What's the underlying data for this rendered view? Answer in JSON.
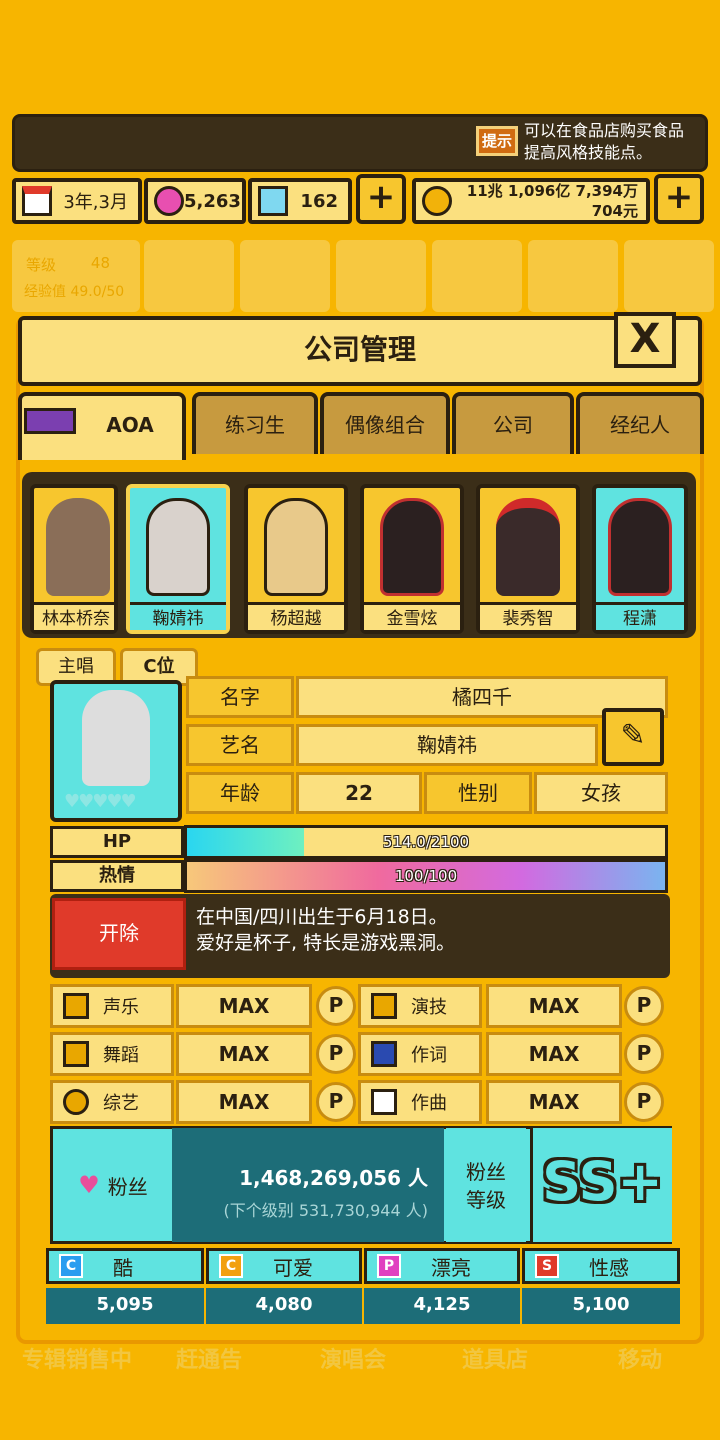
{
  "tip": {
    "badge": "提示",
    "text": "可以在食品店购买食品\n提高风格技能点。"
  },
  "resources": {
    "date": "3年,3月",
    "gems_pink": "5,263",
    "gems_blue": "162",
    "money_line1": "11兆 1,096亿 7,394万",
    "money_line2": "704元",
    "plus": "+"
  },
  "background": {
    "level_label": "等级",
    "level_value": "48",
    "exp_label": "经验值 49.0/50",
    "bottom_menu": [
      "专辑销售中",
      "赶通告",
      "演唱会",
      "道具店",
      "移动"
    ]
  },
  "panel": {
    "title": "公司管理",
    "close": "X"
  },
  "tabs": [
    "AOA",
    "练习生",
    "偶像组合",
    "公司",
    "经纪人"
  ],
  "members": [
    "林本桥奈",
    "鞠婧祎",
    "杨超越",
    "金雪炫",
    "裴秀智",
    "程潇"
  ],
  "selected_member": 1,
  "roles": [
    "主唱",
    "C位"
  ],
  "profile": {
    "name_label": "名字",
    "name_value": "橘四千",
    "stage_label": "艺名",
    "stage_value": "鞠婧祎",
    "age_label": "年龄",
    "age_value": "22",
    "gender_label": "性别",
    "gender_value": "女孩",
    "hearts": "♥♥♥♥♥"
  },
  "bars": {
    "hp_label": "HP",
    "hp_text": "514.0/2100",
    "hp_fraction": 0.245,
    "passion_label": "热情",
    "passion_text": "100/100",
    "passion_fraction": 1.0
  },
  "fire_button": "开除",
  "bio": {
    "line1": "在中国/四川出生于6月18日。",
    "line2": "爱好是杯子, 特长是游戏黑洞。"
  },
  "skills": [
    {
      "name": "声乐",
      "value": "MAX",
      "p": "P"
    },
    {
      "name": "演技",
      "value": "MAX",
      "p": "P"
    },
    {
      "name": "舞蹈",
      "value": "MAX",
      "p": "P"
    },
    {
      "name": "作词",
      "value": "MAX",
      "p": "P"
    },
    {
      "name": "综艺",
      "value": "MAX",
      "p": "P"
    },
    {
      "name": "作曲",
      "value": "MAX",
      "p": "P"
    }
  ],
  "fans": {
    "label": "粉丝",
    "count": "1,468,269,056 人",
    "next": "(下个级别 531,730,944 人)",
    "level_label": "粉丝\n等级",
    "grade": "SS+"
  },
  "attributes": [
    {
      "icon": "C",
      "name": "酷",
      "value": "5,095",
      "color": "#2a9df0"
    },
    {
      "icon": "C",
      "name": "可爱",
      "value": "4,080",
      "color": "#f2a010"
    },
    {
      "icon": "P",
      "name": "漂亮",
      "value": "4,125",
      "color": "#e040c0"
    },
    {
      "icon": "S",
      "name": "性感",
      "value": "5,100",
      "color": "#e03a2a"
    }
  ]
}
